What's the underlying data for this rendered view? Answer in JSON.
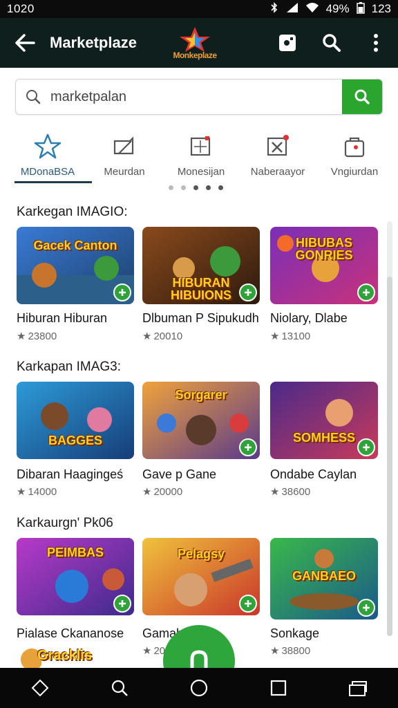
{
  "status_bar": {
    "time": "1020",
    "battery_text": "49%",
    "clock_right": "123"
  },
  "app_bar": {
    "title": "Marketplaze",
    "logo_text": "Monkeplaze"
  },
  "search": {
    "value": "marketpalan"
  },
  "categories": [
    {
      "label": "MDonaBSA",
      "icon": "star-icon"
    },
    {
      "label": "Meurdan",
      "icon": "puzzle-icon"
    },
    {
      "label": "Monesijan",
      "icon": "image-icon"
    },
    {
      "label": "Naberaayor",
      "icon": "cancel-box-icon"
    },
    {
      "label": "Vngiurdan",
      "icon": "bag-icon"
    }
  ],
  "sections": [
    {
      "title": "Karkegan IMAGIO:",
      "items": [
        {
          "name": "Hiburan Hiburan",
          "rating": "23800",
          "art_text": "Gacek Canton"
        },
        {
          "name": "Dlbuman P Sipukudh",
          "rating": "20010",
          "art_text": "HIBURAN HIBUIONS"
        },
        {
          "name": "Niolary, Dlabe",
          "rating": "13100",
          "art_text": "HIBUBAS GONRIES"
        }
      ]
    },
    {
      "title": "Karkapan IMAG3:",
      "items": [
        {
          "name": "Dibaran Haagingeś",
          "rating": "14000",
          "art_text": "BAGGES"
        },
        {
          "name": "Gave p Gane",
          "rating": "20000",
          "art_text": "Sorgarer"
        },
        {
          "name": "Ondabe Caylan",
          "rating": "38600",
          "art_text": "SOMHESS"
        }
      ]
    },
    {
      "title": "Karkaurgn' Pk06",
      "items": [
        {
          "name": "Pialase Ckananose",
          "rating": "",
          "art_text": "PEIMBAS"
        },
        {
          "name": "Gamab",
          "rating": "20",
          "art_text": "Pelagsy"
        },
        {
          "name": "Sonkage",
          "rating": "38800",
          "art_text": "GANBAEO"
        }
      ]
    }
  ],
  "mini_card": {
    "art_text": "Gracklis"
  },
  "colors": {
    "accent_green": "#2aa52e",
    "app_bar": "#0f1f1d"
  }
}
